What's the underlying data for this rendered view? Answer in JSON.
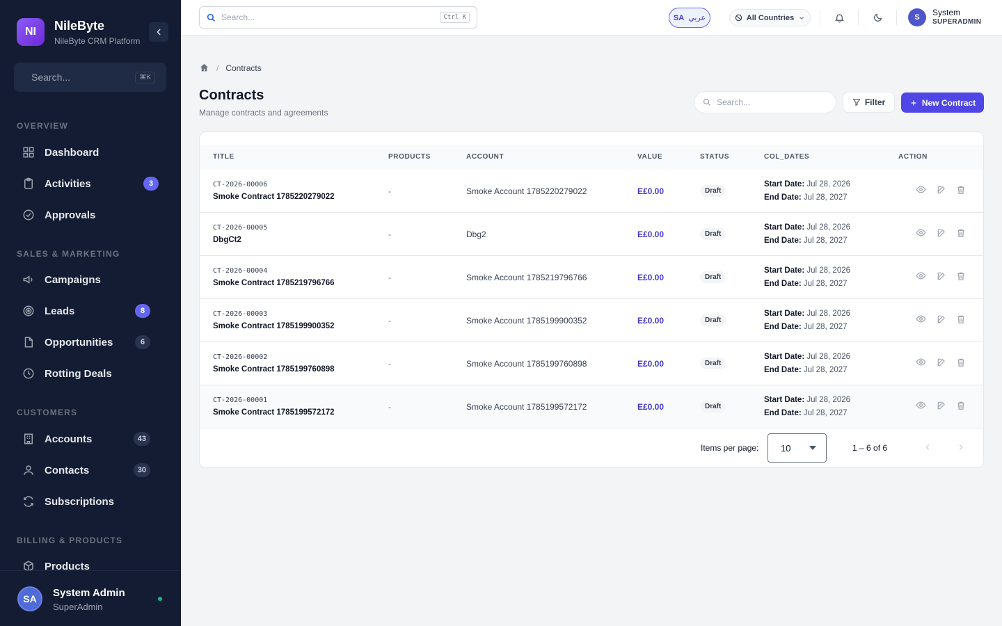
{
  "brand": {
    "logo": "NI",
    "name": "NileByte",
    "subtitle": "NileByte CRM Platform"
  },
  "sidebar": {
    "search_placeholder": "Search...",
    "search_shortcut": "⌘K",
    "sections": {
      "overview": "OVERVIEW",
      "sales": "SALES & MARKETING",
      "customers": "CUSTOMERS",
      "billing": "BILLING & PRODUCTS"
    },
    "items": [
      {
        "label": "Dashboard",
        "icon": "grid-icon"
      },
      {
        "label": "Activities",
        "icon": "clipboard-icon",
        "badge": "3"
      },
      {
        "label": "Approvals",
        "icon": "check-circle-icon"
      },
      {
        "label": "Campaigns",
        "icon": "megaphone-icon"
      },
      {
        "label": "Leads",
        "icon": "target-icon",
        "badge": "8"
      },
      {
        "label": "Opportunities",
        "icon": "file-icon",
        "badge": "6"
      },
      {
        "label": "Rotting Deals",
        "icon": "clock-icon"
      },
      {
        "label": "Accounts",
        "icon": "building-icon",
        "badge": "43"
      },
      {
        "label": "Contacts",
        "icon": "user-icon",
        "badge": "30"
      },
      {
        "label": "Subscriptions",
        "icon": "refresh-icon"
      },
      {
        "label": "Products",
        "icon": "box-icon"
      }
    ],
    "user": {
      "initials": "SA",
      "name": "System Admin",
      "role": "SuperAdmin"
    }
  },
  "topbar": {
    "search_placeholder": "Search...",
    "search_shortcut": "Ctrl K",
    "lang_code": "SA",
    "lang_label": "عربي",
    "country": "All Countries",
    "user": {
      "initial": "S",
      "name": "System",
      "role": "SUPERADMIN"
    }
  },
  "breadcrumb": {
    "current": "Contracts"
  },
  "page": {
    "title": "Contracts",
    "subtitle": "Manage contracts and agreements",
    "search_placeholder": "Search...",
    "filter_label": "Filter",
    "new_label": "New Contract"
  },
  "table": {
    "headers": [
      "TITLE",
      "PRODUCTS",
      "ACCOUNT",
      "VALUE",
      "STATUS",
      "COL_DATES",
      "ACTION"
    ],
    "start_label": "Start Date:",
    "end_label": "End Date:",
    "rows": [
      {
        "code": "CT-2026-00006",
        "name": "Smoke Contract 1785220279022",
        "products": "-",
        "account": "Smoke Account 1785220279022",
        "value": "E£0.00",
        "status": "Draft",
        "start": "Jul 28, 2026",
        "end": "Jul 28, 2027"
      },
      {
        "code": "CT-2026-00005",
        "name": "DbgCt2",
        "products": "-",
        "account": "Dbg2",
        "value": "E£0.00",
        "status": "Draft",
        "start": "Jul 28, 2026",
        "end": "Jul 28, 2027"
      },
      {
        "code": "CT-2026-00004",
        "name": "Smoke Contract 1785219796766",
        "products": "-",
        "account": "Smoke Account 1785219796766",
        "value": "E£0.00",
        "status": "Draft",
        "start": "Jul 28, 2026",
        "end": "Jul 28, 2027"
      },
      {
        "code": "CT-2026-00003",
        "name": "Smoke Contract 1785199900352",
        "products": "-",
        "account": "Smoke Account 1785199900352",
        "value": "E£0.00",
        "status": "Draft",
        "start": "Jul 28, 2026",
        "end": "Jul 28, 2027"
      },
      {
        "code": "CT-2026-00002",
        "name": "Smoke Contract 1785199760898",
        "products": "-",
        "account": "Smoke Account 1785199760898",
        "value": "E£0.00",
        "status": "Draft",
        "start": "Jul 28, 2026",
        "end": "Jul 28, 2027"
      },
      {
        "code": "CT-2026-00001",
        "name": "Smoke Contract 1785199572172",
        "products": "-",
        "account": "Smoke Account 1785199572172",
        "value": "E£0.00",
        "status": "Draft",
        "start": "Jul 28, 2026",
        "end": "Jul 28, 2027"
      }
    ]
  },
  "pager": {
    "label": "Items per page:",
    "per_page": "10",
    "range": "1 – 6 of 6"
  },
  "colors": {
    "primary": "#4f46e5",
    "sidebar": "#141c33",
    "value": "#4338ca"
  }
}
